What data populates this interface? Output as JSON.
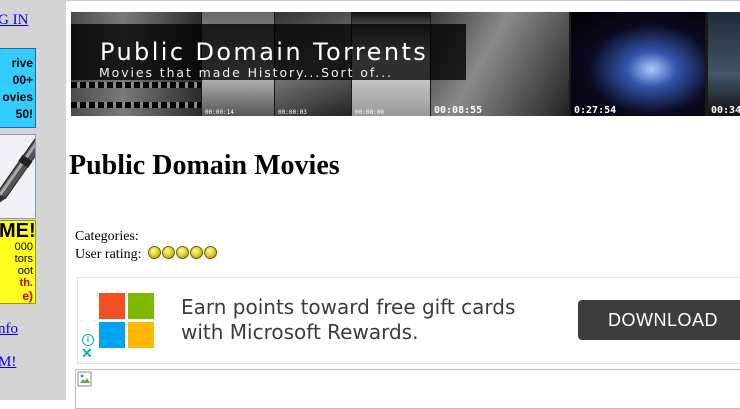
{
  "sidebar": {
    "login_link": "G IN",
    "promo_blue_lines": [
      "rive",
      "00+",
      "ovies",
      "50!"
    ],
    "promo_yellow": {
      "big": "ME!",
      "lines": [
        "000",
        "tors",
        "oot",
        "th."
      ],
      "red": "e)"
    },
    "info_link": "nfo",
    "m_link": "M!"
  },
  "banner": {
    "title": "Public Domain Torrents",
    "subtitle": "Movies that made History...Sort of...",
    "timestamps": [
      "00:08:55",
      "0:27:54",
      "00:34:"
    ],
    "small_timestamps": [
      "00:00:14",
      "00:00:03",
      "00:00:00"
    ]
  },
  "page": {
    "title": "Public Domain Movies",
    "categories_label": "Categories:",
    "rating_label": "User rating:",
    "rating_stars": 5
  },
  "ad": {
    "line1": "Earn points toward free gift cards",
    "line2": "with Microsoft Rewards.",
    "button": "DOWNLOAD",
    "brand_colors": {
      "red": "#f25022",
      "green": "#7fba00",
      "blue": "#00a4ef",
      "yellow": "#ffb900"
    },
    "info_icon": "info-icon",
    "close_icon": "close-icon"
  },
  "broken_image": {
    "icon": "broken-image-icon"
  }
}
